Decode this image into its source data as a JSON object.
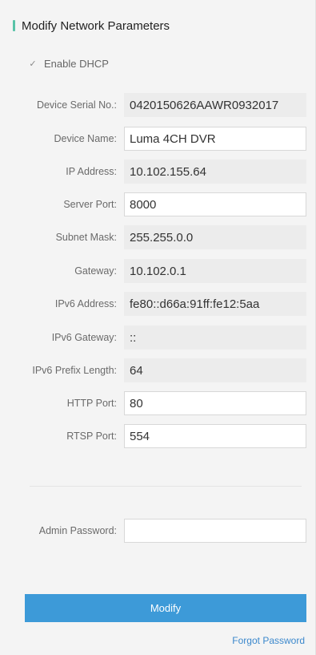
{
  "header": {
    "title": "Modify Network Parameters"
  },
  "dhcp": {
    "label": "Enable DHCP",
    "checked": true
  },
  "fields": {
    "serial": {
      "label": "Device Serial No.:",
      "value": "0420150626AAWR0932017"
    },
    "name": {
      "label": "Device Name:",
      "value": "Luma 4CH DVR"
    },
    "ip": {
      "label": "IP Address:",
      "value": "10.102.155.64"
    },
    "server_port": {
      "label": "Server Port:",
      "value": "8000"
    },
    "subnet": {
      "label": "Subnet Mask:",
      "value": "255.255.0.0"
    },
    "gateway": {
      "label": "Gateway:",
      "value": "10.102.0.1"
    },
    "ipv6_address": {
      "label": "IPv6 Address:",
      "value": "fe80::d66a:91ff:fe12:5aa"
    },
    "ipv6_gateway": {
      "label": "IPv6 Gateway:",
      "value": "::"
    },
    "ipv6_prefix": {
      "label": "IPv6 Prefix Length:",
      "value": "64"
    },
    "http_port": {
      "label": "HTTP Port:",
      "value": "80"
    },
    "rtsp_port": {
      "label": "RTSP Port:",
      "value": "554"
    }
  },
  "password": {
    "label": "Admin Password:",
    "value": ""
  },
  "actions": {
    "modify": "Modify",
    "forgot": "Forgot Password"
  },
  "colors": {
    "accent": "#59c3a8",
    "button": "#3d9ad8",
    "link": "#3b88cc"
  }
}
